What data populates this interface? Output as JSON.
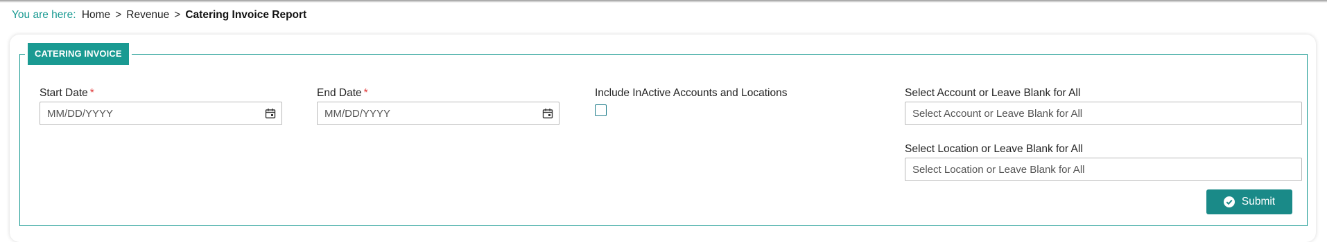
{
  "breadcrumb": {
    "prefix": "You are here:",
    "items": [
      "Home",
      "Revenue"
    ],
    "separator": ">",
    "current": "Catering Invoice Report"
  },
  "form": {
    "legend": "CATERING INVOICE",
    "start_date": {
      "label": "Start Date",
      "required_mark": "*",
      "placeholder": "MM/DD/YYYY",
      "value": ""
    },
    "end_date": {
      "label": "End Date",
      "required_mark": "*",
      "placeholder": "MM/DD/YYYY",
      "value": ""
    },
    "include_inactive": {
      "label": "Include InActive Accounts and Locations",
      "checked": false
    },
    "account": {
      "label": "Select Account or Leave Blank for All",
      "placeholder": "Select Account or Leave Blank for All",
      "value": ""
    },
    "location": {
      "label": "Select Location or Leave Blank for All",
      "placeholder": "Select Location or Leave Blank for All",
      "value": ""
    },
    "submit_label": "Submit"
  },
  "icons": {
    "date_picker": "calendar-icon",
    "submit": "check-circle-icon"
  },
  "colors": {
    "accent": "#1a9a92",
    "button": "#1a8a88",
    "required": "#e03a3a"
  }
}
